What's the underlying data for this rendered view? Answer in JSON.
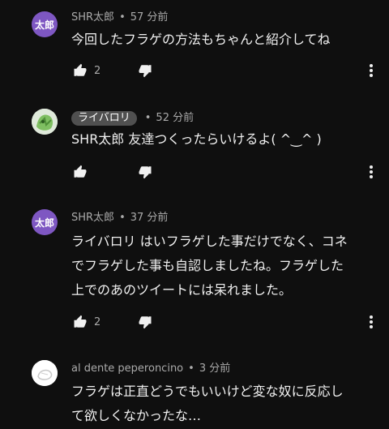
{
  "comments": [
    {
      "avatar_text": "太郎",
      "author": "SHR太郎",
      "author_is_chip": false,
      "time": "57 分前",
      "text_lines": [
        "今回したフラゲの方法もちゃんと紹介してね"
      ],
      "likes": "2"
    },
    {
      "avatar_text": "",
      "author": "ライバロリ",
      "author_is_chip": true,
      "time": "52 分前",
      "text_lines": [
        "SHR太郎 友達つくったらいけるよ( ^‿^ )"
      ],
      "likes": ""
    },
    {
      "avatar_text": "太郎",
      "author": "SHR太郎",
      "author_is_chip": false,
      "time": "37 分前",
      "text_lines": [
        "ライバロリ はいフラゲした事だけでなく、コネ",
        "でフラゲした事も自認しましたね。フラゲした",
        "上でのあのツイートには呆れました。"
      ],
      "likes": "2"
    },
    {
      "avatar_text": "",
      "author": "al dente peperoncino",
      "author_is_chip": false,
      "time": "3 分前",
      "text_lines": [
        "フラゲは正直どうでもいいけど変な奴に反応し",
        "て欲しくなかったな…"
      ],
      "likes": ""
    }
  ],
  "separator": "•",
  "icons": {
    "like": "thumbs-up-icon",
    "dislike": "thumbs-down-icon",
    "more": "more-vert-icon"
  }
}
